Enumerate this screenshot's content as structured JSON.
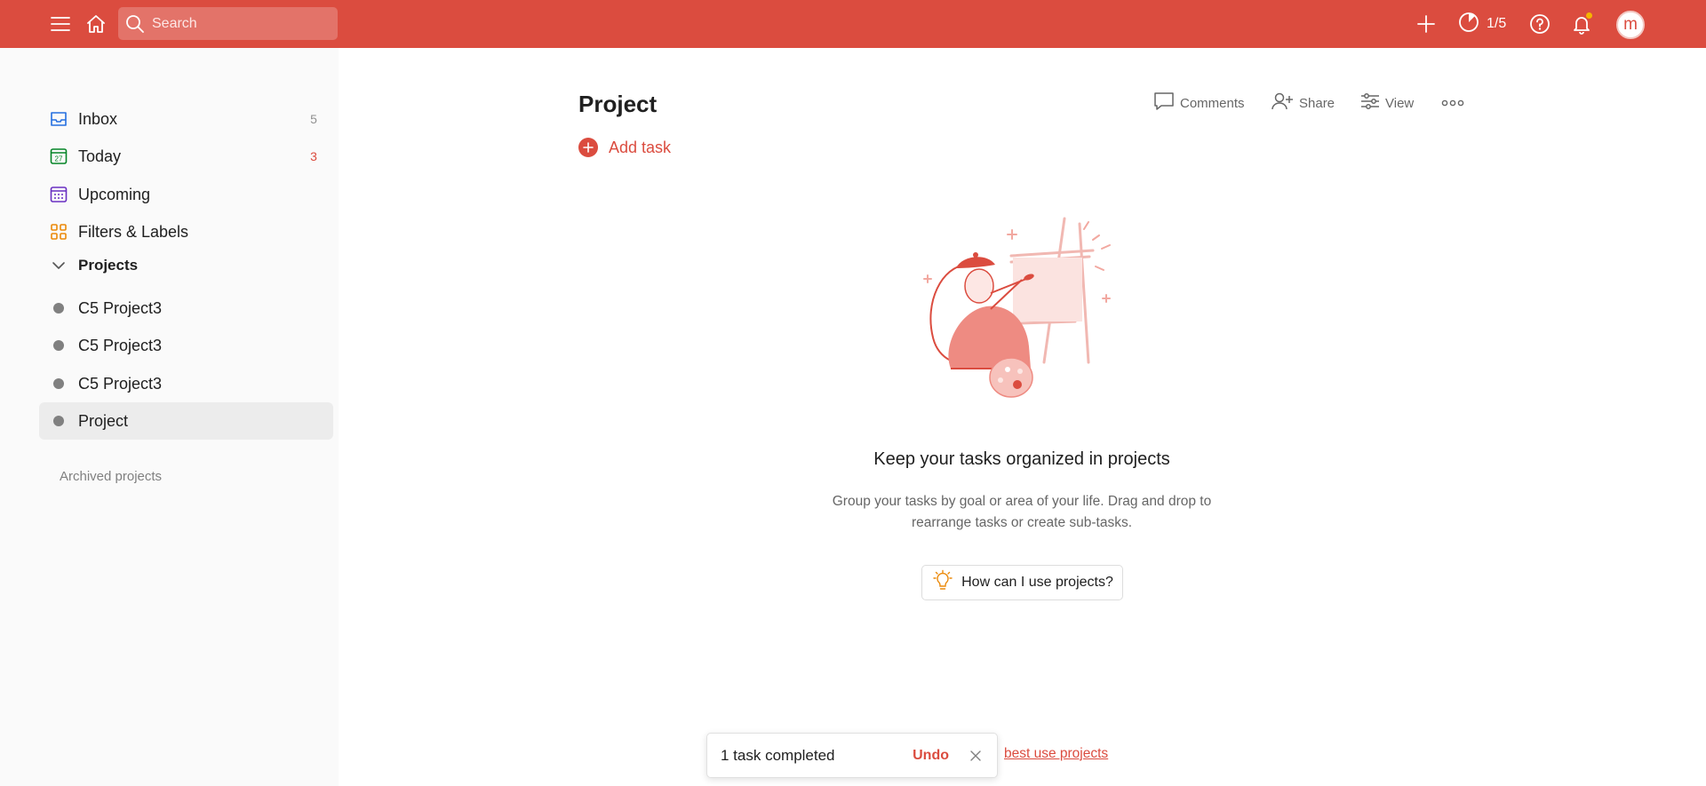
{
  "topbar": {
    "search_placeholder": "Search",
    "karma_progress": "1/5",
    "avatar_letter": "m",
    "accent_color": "#db4c3f"
  },
  "sidebar": {
    "nav": [
      {
        "label": "Inbox",
        "count": "5",
        "icon": "inbox-icon"
      },
      {
        "label": "Today",
        "count": "3",
        "icon": "calendar-today-icon",
        "day": "27"
      },
      {
        "label": "Upcoming",
        "count": "",
        "icon": "calendar-grid-icon"
      },
      {
        "label": "Filters & Labels",
        "count": "",
        "icon": "filters-grid-icon"
      }
    ],
    "projects_header": "Projects",
    "projects": [
      {
        "label": "C5 Project3"
      },
      {
        "label": "C5 Project3"
      },
      {
        "label": "C5 Project3"
      },
      {
        "label": "Project",
        "active": true
      }
    ],
    "archived_label": "Archived projects"
  },
  "main": {
    "title": "Project",
    "actions": {
      "comments": "Comments",
      "share": "Share",
      "view": "View"
    },
    "add_task": "Add task",
    "empty_state": {
      "title": "Keep your tasks organized in projects",
      "desc_line1": "Group your tasks by goal or area of your life. Drag and drop to",
      "desc_line2": "rearrange tasks or create sub-tasks.",
      "help_button": "How can I use projects?"
    },
    "learn_link": "best use projects"
  },
  "toast": {
    "message": "1 task completed",
    "undo": "Undo"
  }
}
